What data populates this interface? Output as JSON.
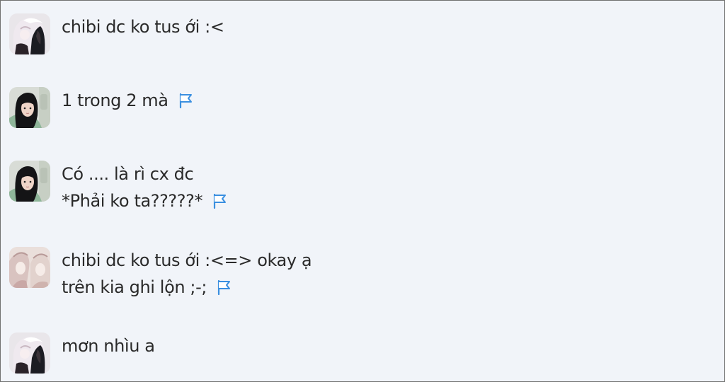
{
  "messages": [
    {
      "avatar": "dark-haired-anime-girl-avatar",
      "lines": [
        "chibi dc ko tus ới :<"
      ],
      "flag": false
    },
    {
      "avatar": "girl-selfie-avatar",
      "lines": [
        "1 trong 2 mà"
      ],
      "flag": true
    },
    {
      "avatar": "girl-selfie-avatar",
      "lines": [
        "Có .... là rì cx đc",
        "*Phải ko ta?????*"
      ],
      "flag": true
    },
    {
      "avatar": "pastel-anime-girls-avatar",
      "lines": [
        "chibi dc ko tus ới :<=> okay ạ",
        "trên kia ghi lộn ;-;"
      ],
      "flag": true
    },
    {
      "avatar": "dark-haired-anime-girl-avatar",
      "lines": [
        "mơn nhìu a"
      ],
      "flag": false
    }
  ],
  "colors": {
    "background": "#f1f4f9",
    "text": "#2a2a2a",
    "flag": "#3a8fe0",
    "border": "#707070"
  },
  "icons": {
    "flag": "flag-icon"
  }
}
